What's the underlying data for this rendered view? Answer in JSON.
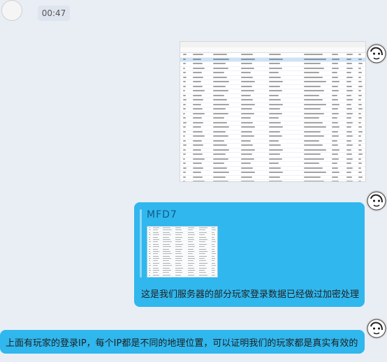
{
  "chat": {
    "timestamp": "00:47",
    "messages": [
      {
        "type": "image",
        "caption": "Screenshot of database table with player login records"
      },
      {
        "type": "quote",
        "author": "MFD7",
        "text": "这是我们服务器的部分玩家登录数据已经做过加密处理"
      },
      {
        "type": "text",
        "text": "上面有玩家的登录IP，每个IP都是不同的地理位置，可以证明我们的玩家都是真实有效的"
      }
    ]
  },
  "icons": {
    "avatar": "cartoon-face-icon",
    "table": "table-grid-icon"
  },
  "colors": {
    "bubble": "#2fb7ee",
    "background": "#e9eef5",
    "quote_author": "#0f5b85",
    "text": "#222222"
  }
}
